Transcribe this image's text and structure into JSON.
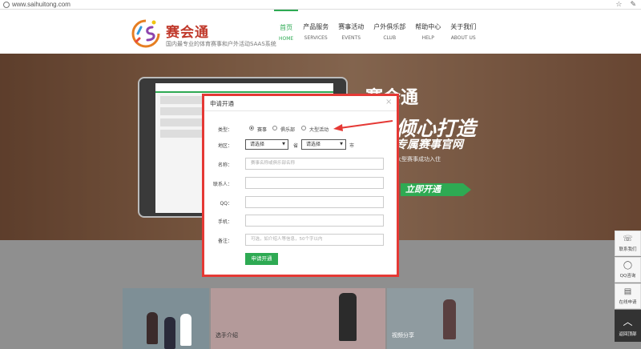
{
  "browser": {
    "url": "www.saihuitong.com"
  },
  "header": {
    "brand": "赛会通",
    "tagline": "国内最专业的体育赛事和户外活动SAAS系统",
    "nav": [
      {
        "zh": "首页",
        "en": "HOME",
        "active": true
      },
      {
        "zh": "产品服务",
        "en": "SERVICES"
      },
      {
        "zh": "赛事活动",
        "en": "EVENTS"
      },
      {
        "zh": "户外俱乐部",
        "en": "CLUB"
      },
      {
        "zh": "帮助中心",
        "en": "HELP"
      },
      {
        "zh": "关于我们",
        "en": "ABOUT US"
      }
    ]
  },
  "banner": {
    "title": "赛会通",
    "slogan1": "倾心打造",
    "slogan2": "专属赛事官网",
    "small": "大型赛事成功入住",
    "cta": "立即开通"
  },
  "modal": {
    "title": "申请开通",
    "close": "×",
    "type_label": "类型：",
    "type_options": [
      "赛事",
      "俱乐部",
      "大型活动"
    ],
    "region_label": "地区：",
    "province_placeholder": "请选择",
    "province_unit": "省",
    "city_placeholder": "请选择",
    "city_unit": "市",
    "name_label": "名称：",
    "name_placeholder": "赛事名称或俱乐部名称",
    "contact_label": "联系人：",
    "qq_label": "QQ：",
    "phone_label": "手机：",
    "note_label": "备注：",
    "note_placeholder": "可选，如介绍人等信息，50个字以内",
    "submit": "申请开通"
  },
  "cards": [
    {
      "caption": ""
    },
    {
      "caption": "选手介绍"
    },
    {
      "caption": "视频分享"
    }
  ],
  "sidebar": [
    {
      "label": "联系我们",
      "icon": "phone-icon"
    },
    {
      "label": "QQ咨询",
      "icon": "qq-icon"
    },
    {
      "label": "在线申请",
      "icon": "form-icon"
    },
    {
      "label": "返回顶部",
      "icon": "chevron-up-icon"
    }
  ],
  "colors": {
    "accent": "#2eaa53",
    "highlight": "#e53935"
  }
}
